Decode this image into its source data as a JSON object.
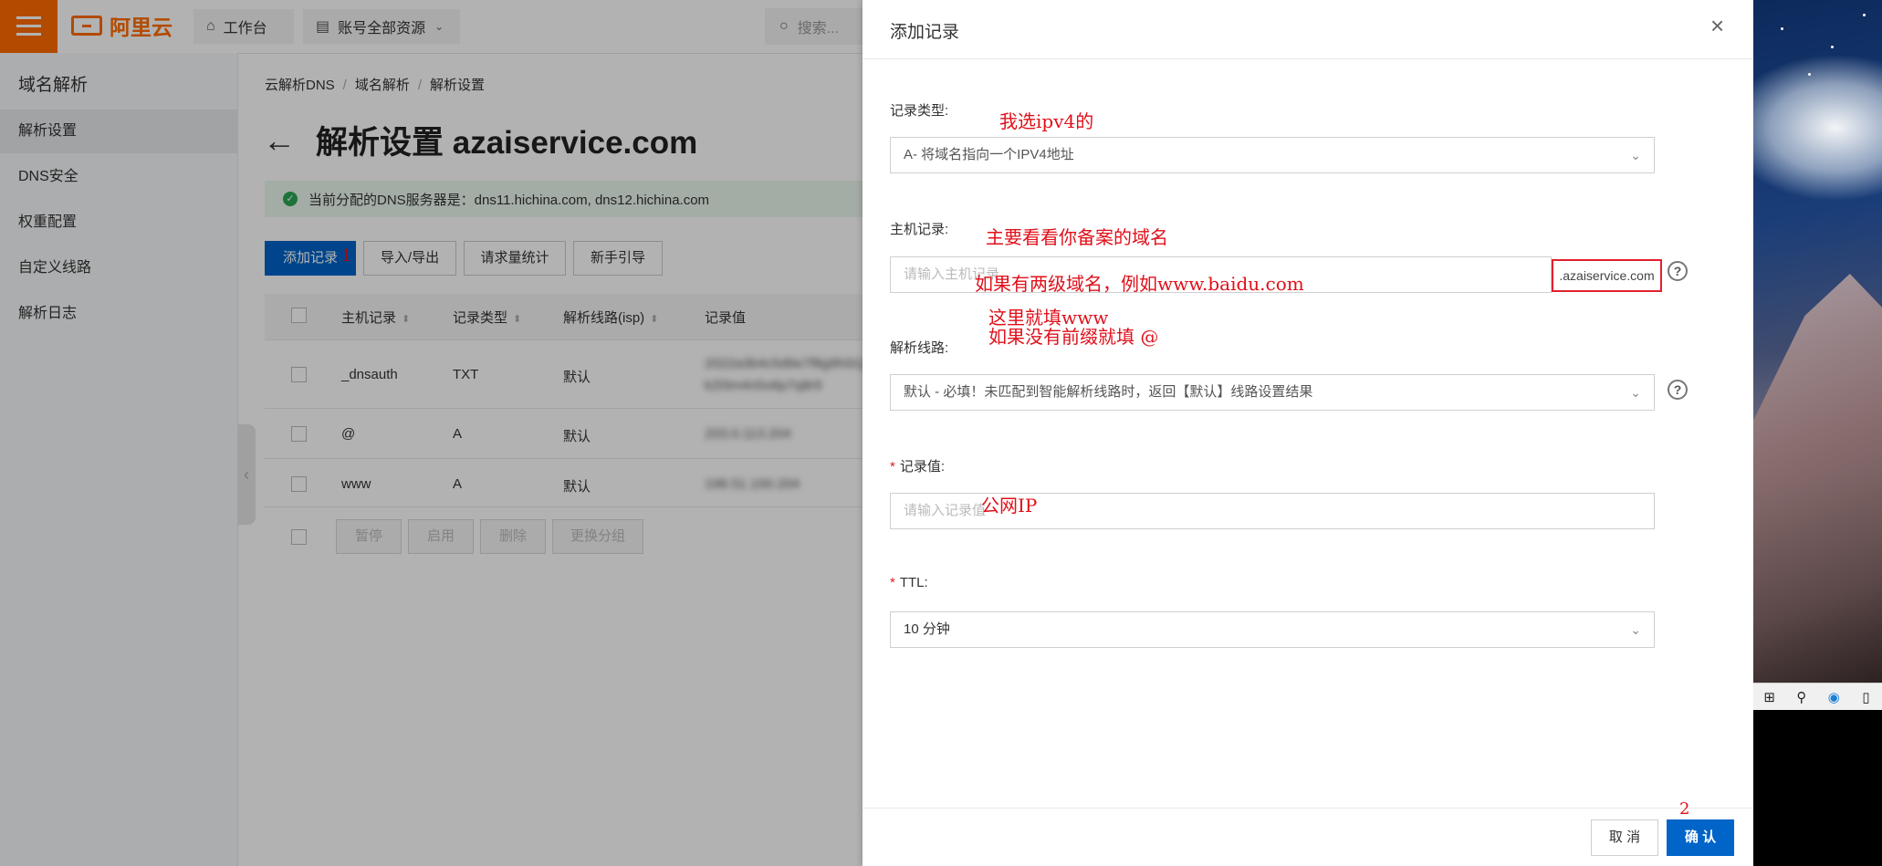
{
  "header": {
    "logo_text": "阿里云",
    "workbench_label": "工作台",
    "resources_label": "账号全部资源",
    "search_placeholder": "搜索..."
  },
  "sidebar": {
    "title": "域名解析",
    "items": [
      {
        "label": "解析设置",
        "active": true
      },
      {
        "label": "DNS安全"
      },
      {
        "label": "权重配置"
      },
      {
        "label": "自定义线路"
      },
      {
        "label": "解析日志"
      }
    ]
  },
  "breadcrumb": [
    "云解析DNS",
    "域名解析",
    "解析设置"
  ],
  "page": {
    "title": "解析设置 azaiservice.com",
    "dns_info": "当前分配的DNS服务器是：dns11.hichina.com, dns12.hichina.com"
  },
  "toolbar": {
    "add_record": "添加记录",
    "import_export": "导入/导出",
    "request_stats": "请求量统计",
    "guide": "新手引导"
  },
  "table": {
    "columns": [
      "主机记录",
      "记录类型",
      "解析线路(isp)",
      "记录值"
    ],
    "rows": [
      {
        "host": "_dnsauth",
        "type": "TXT",
        "line": "默认",
        "value": "2022a3b4c5d6e7f8g9h0i1j",
        "value2": "k2l3m4n5o6p7q8r9"
      },
      {
        "host": "@",
        "type": "A",
        "line": "默认",
        "value": "203.0.113.204"
      },
      {
        "host": "www",
        "type": "A",
        "line": "默认",
        "value": "198.51.100.204"
      }
    ],
    "batch_buttons": [
      "暂停",
      "启用",
      "删除",
      "更换分组"
    ]
  },
  "drawer": {
    "title": "添加记录",
    "record_type": {
      "label": "记录类型:",
      "value": "A- 将域名指向一个IPV4地址"
    },
    "host_record": {
      "label": "主机记录:",
      "placeholder": "请输入主机记录",
      "suffix": ".azaiservice.com"
    },
    "line": {
      "label": "解析线路:",
      "value": "默认 - 必填！未匹配到智能解析线路时，返回【默认】线路设置结果"
    },
    "record_value": {
      "label": "记录值:",
      "placeholder": "请输入记录值"
    },
    "ttl": {
      "label": "TTL:",
      "value": "10 分钟"
    },
    "cancel": "取 消",
    "confirm": "确 认"
  },
  "annotations": {
    "a1": "1",
    "a2": "2",
    "record_type_note": "我选ipv4的",
    "host_note_1": "主要看看你备案的域名",
    "host_note_2": "如果有两级域名，例如www.baidu.com",
    "host_note_3": "这里就填www",
    "host_note_4": "如果没有前缀就填  @",
    "value_note": "公网IP"
  },
  "colors": {
    "brand_orange": "#ff6a00",
    "primary_blue": "#0064c8",
    "annotation_red": "#e0101a",
    "success_green": "#2aa652"
  }
}
